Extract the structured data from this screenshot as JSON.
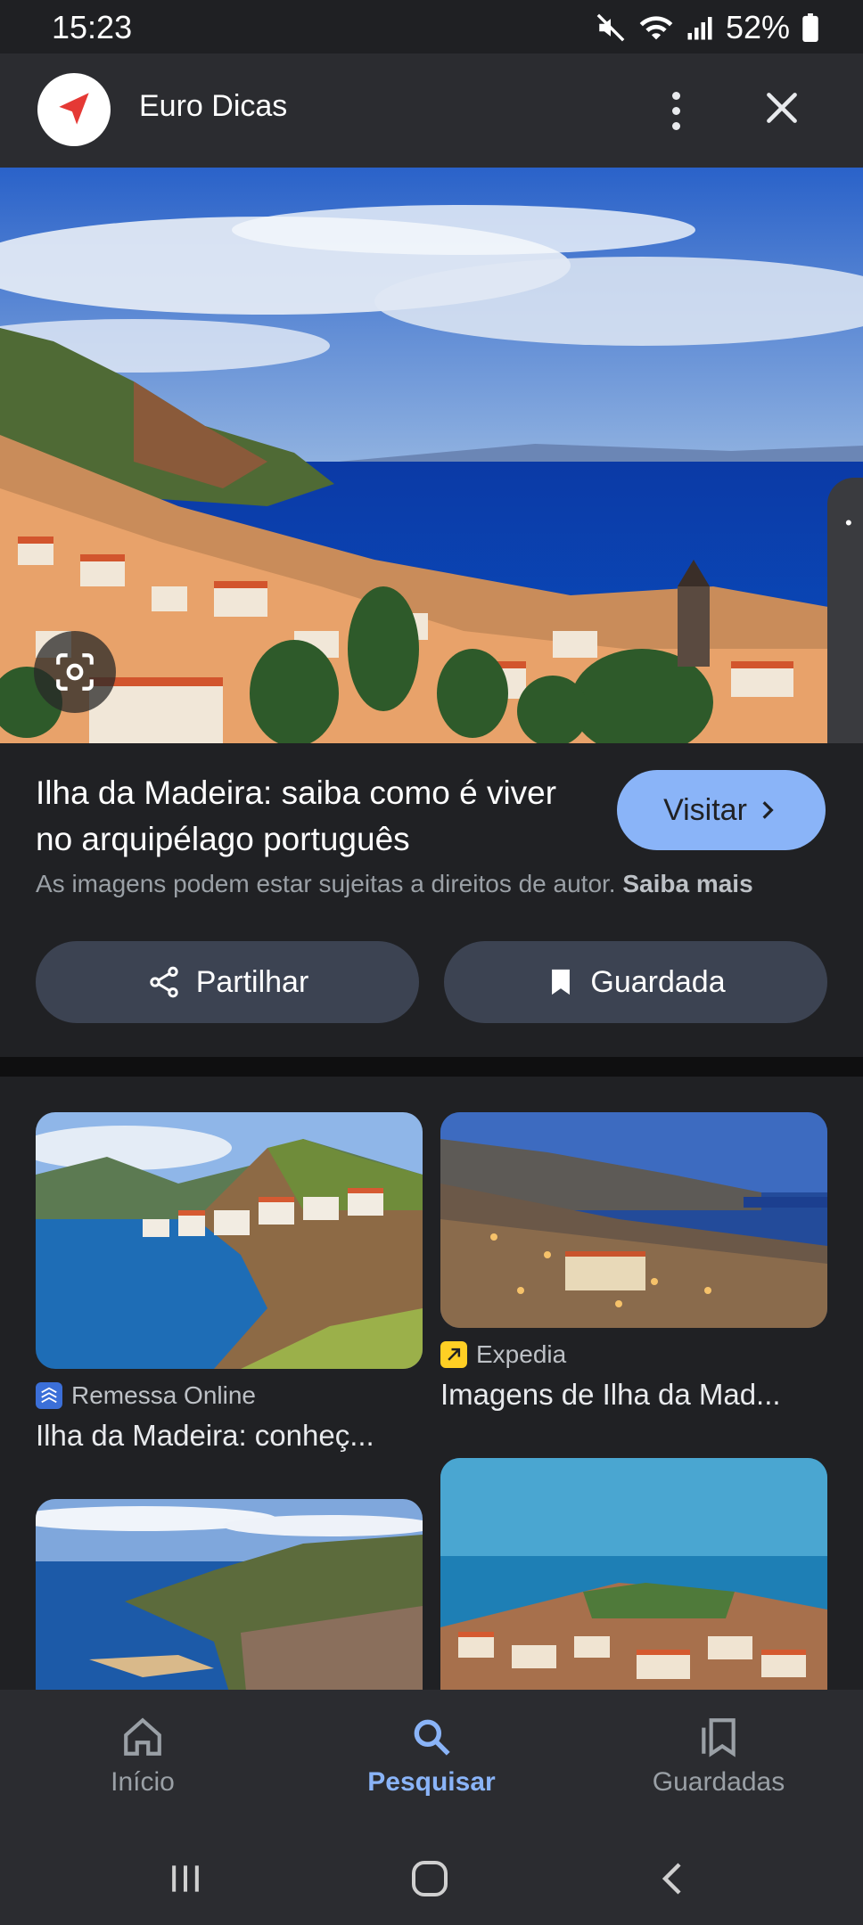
{
  "status_bar": {
    "time": "15:23",
    "battery": "52%"
  },
  "app_bar": {
    "title": "Euro Dicas"
  },
  "result": {
    "headline": "Ilha da Madeira: saiba como é viver no arquipélago português",
    "visit_label": "Visitar",
    "copyright_text": "As imagens podem estar sujeitas a direitos de autor.",
    "learn_more": "Saiba mais",
    "share_label": "Partilhar",
    "saved_label": "Guardada"
  },
  "related": [
    {
      "source": "Remessa Online",
      "title": "Ilha da Madeira: conheç..."
    },
    {
      "source": "Expedia",
      "title": "Imagens de Ilha da Mad..."
    }
  ],
  "bottom_nav": {
    "home": "Início",
    "search": "Pesquisar",
    "saved": "Guardadas"
  },
  "colors": {
    "accent": "#8ab4f8",
    "background": "#202124",
    "pill": "#3c4352"
  }
}
